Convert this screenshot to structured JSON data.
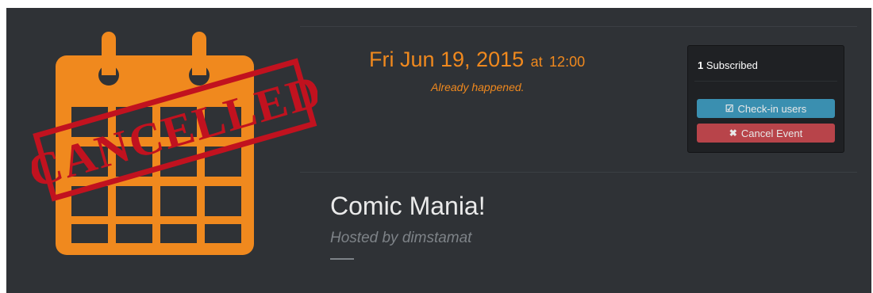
{
  "event": {
    "date": "Fri Jun 19, 2015",
    "at_label": "at",
    "time": "12:00",
    "status": "Already happened.",
    "title": "Comic Mania!",
    "host_text": "Hosted by dimstamat",
    "stamp_text": "CANCELLED"
  },
  "subscription": {
    "count": "1",
    "label": "Subscribed"
  },
  "actions": {
    "checkin_label": "Check-in users",
    "checkin_icon": "check-square-icon",
    "cancel_label": "Cancel Event",
    "cancel_icon": "times-icon"
  },
  "colors": {
    "accent": "#f0891e",
    "panel": "#2f3236",
    "info_button": "#3a8fb0",
    "danger_button": "#b8444a",
    "stamp_red": "#c1121f"
  }
}
